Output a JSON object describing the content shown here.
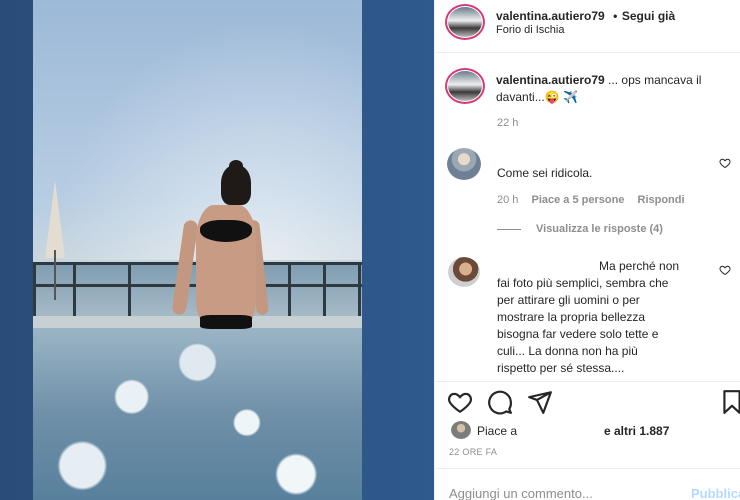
{
  "header": {
    "username": "valentina.autiero79",
    "separator": "•",
    "follow_label": "Segui già",
    "location": "Forio di Ischia"
  },
  "caption": {
    "username": "valentina.autiero79",
    "text_line1": " ... ops mancava il",
    "text_line2": "davanti...",
    "emoji": "😜 ✈️",
    "time": "22 h"
  },
  "comments": [
    {
      "text": "Come sei ridicola.",
      "time": "20 h",
      "likes": "Piace a 5 persone",
      "reply_label": "Rispondi",
      "view_replies": "Visualizza le risposte (4)"
    },
    {
      "lines": [
        "Ma perché non",
        "fai foto più semplici, sembra che",
        "per attirare gli uomini o per",
        "mostrare la propria bellezza",
        "bisogna far vedere solo tette e",
        "culi... La donna non ha più",
        "rispetto per sé stessa...."
      ]
    }
  ],
  "actions": {
    "icons": [
      "heart-icon",
      "comment-icon",
      "share-icon",
      "bookmark-icon"
    ]
  },
  "likes": {
    "prefix": "Piace a",
    "suffix": "e altri 1.887"
  },
  "timestamp": "22 ORE FA",
  "add_comment": {
    "placeholder": "Aggiungi un commento...",
    "publish_label": "Pubblica"
  },
  "colors": {
    "background": "#2c4f7c",
    "publish": "#b3dbff",
    "story_ring": "#d33c7a"
  }
}
